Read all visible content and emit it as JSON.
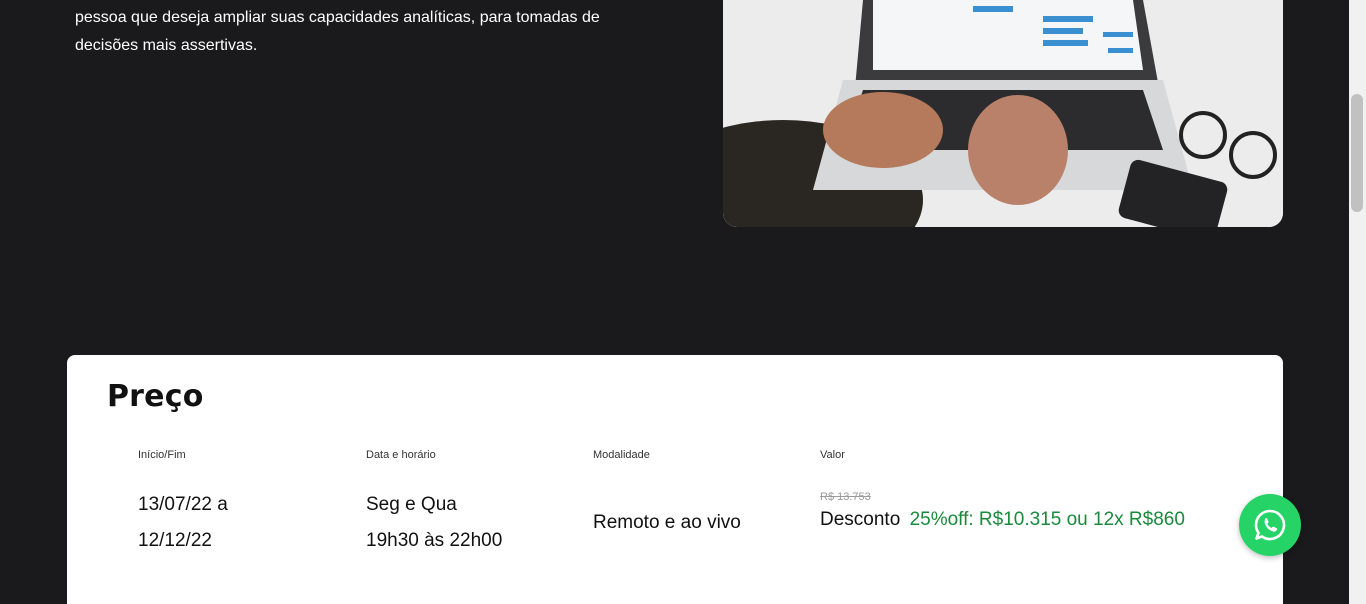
{
  "intro": {
    "line1": "pessoa que deseja ampliar suas capacidades analíticas, para tomadas de",
    "line2": "decisões mais assertivas."
  },
  "hero_image": {
    "alt": "laptop-typing-photo"
  },
  "price_section": {
    "title": "Preço",
    "columns": {
      "dates": {
        "label": "Início/Fim",
        "line1": "13/07/22 a",
        "line2": "12/12/22"
      },
      "schedule": {
        "label": "Data e horário",
        "line1": "Seg e Qua",
        "line2": "19h30 às 22h00"
      },
      "mode": {
        "label": "Modalidade",
        "value": "Remoto e ao vivo"
      },
      "price": {
        "label": "Valor",
        "old_price": "R$ 13.753",
        "discount_label": "Desconto",
        "discount_offer": "25%off: R$10.315 ou 12x R$860"
      }
    }
  },
  "whatsapp": {
    "icon": "whatsapp-icon"
  },
  "colors": {
    "background": "#1a191c",
    "card": "#ffffff",
    "discount_green": "#1a8a3c",
    "whatsapp_green": "#25d366"
  }
}
